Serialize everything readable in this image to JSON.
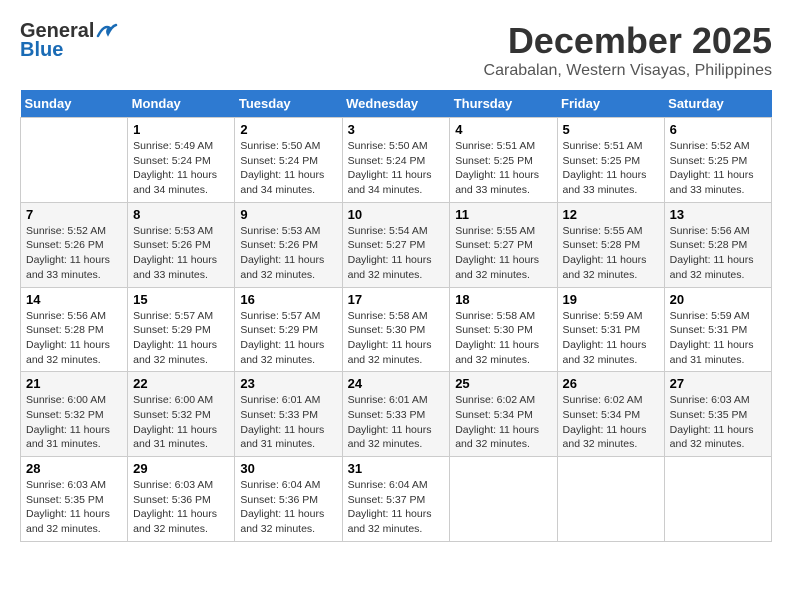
{
  "header": {
    "logo_general": "General",
    "logo_blue": "Blue",
    "month": "December 2025",
    "location": "Carabalan, Western Visayas, Philippines"
  },
  "weekdays": [
    "Sunday",
    "Monday",
    "Tuesday",
    "Wednesday",
    "Thursday",
    "Friday",
    "Saturday"
  ],
  "weeks": [
    [
      {
        "day": "",
        "info": ""
      },
      {
        "day": "1",
        "info": "Sunrise: 5:49 AM\nSunset: 5:24 PM\nDaylight: 11 hours and 34 minutes."
      },
      {
        "day": "2",
        "info": "Sunrise: 5:50 AM\nSunset: 5:24 PM\nDaylight: 11 hours and 34 minutes."
      },
      {
        "day": "3",
        "info": "Sunrise: 5:50 AM\nSunset: 5:24 PM\nDaylight: 11 hours and 34 minutes."
      },
      {
        "day": "4",
        "info": "Sunrise: 5:51 AM\nSunset: 5:25 PM\nDaylight: 11 hours and 33 minutes."
      },
      {
        "day": "5",
        "info": "Sunrise: 5:51 AM\nSunset: 5:25 PM\nDaylight: 11 hours and 33 minutes."
      },
      {
        "day": "6",
        "info": "Sunrise: 5:52 AM\nSunset: 5:25 PM\nDaylight: 11 hours and 33 minutes."
      }
    ],
    [
      {
        "day": "7",
        "info": "Sunrise: 5:52 AM\nSunset: 5:26 PM\nDaylight: 11 hours and 33 minutes."
      },
      {
        "day": "8",
        "info": "Sunrise: 5:53 AM\nSunset: 5:26 PM\nDaylight: 11 hours and 33 minutes."
      },
      {
        "day": "9",
        "info": "Sunrise: 5:53 AM\nSunset: 5:26 PM\nDaylight: 11 hours and 32 minutes."
      },
      {
        "day": "10",
        "info": "Sunrise: 5:54 AM\nSunset: 5:27 PM\nDaylight: 11 hours and 32 minutes."
      },
      {
        "day": "11",
        "info": "Sunrise: 5:55 AM\nSunset: 5:27 PM\nDaylight: 11 hours and 32 minutes."
      },
      {
        "day": "12",
        "info": "Sunrise: 5:55 AM\nSunset: 5:28 PM\nDaylight: 11 hours and 32 minutes."
      },
      {
        "day": "13",
        "info": "Sunrise: 5:56 AM\nSunset: 5:28 PM\nDaylight: 11 hours and 32 minutes."
      }
    ],
    [
      {
        "day": "14",
        "info": "Sunrise: 5:56 AM\nSunset: 5:28 PM\nDaylight: 11 hours and 32 minutes."
      },
      {
        "day": "15",
        "info": "Sunrise: 5:57 AM\nSunset: 5:29 PM\nDaylight: 11 hours and 32 minutes."
      },
      {
        "day": "16",
        "info": "Sunrise: 5:57 AM\nSunset: 5:29 PM\nDaylight: 11 hours and 32 minutes."
      },
      {
        "day": "17",
        "info": "Sunrise: 5:58 AM\nSunset: 5:30 PM\nDaylight: 11 hours and 32 minutes."
      },
      {
        "day": "18",
        "info": "Sunrise: 5:58 AM\nSunset: 5:30 PM\nDaylight: 11 hours and 32 minutes."
      },
      {
        "day": "19",
        "info": "Sunrise: 5:59 AM\nSunset: 5:31 PM\nDaylight: 11 hours and 32 minutes."
      },
      {
        "day": "20",
        "info": "Sunrise: 5:59 AM\nSunset: 5:31 PM\nDaylight: 11 hours and 31 minutes."
      }
    ],
    [
      {
        "day": "21",
        "info": "Sunrise: 6:00 AM\nSunset: 5:32 PM\nDaylight: 11 hours and 31 minutes."
      },
      {
        "day": "22",
        "info": "Sunrise: 6:00 AM\nSunset: 5:32 PM\nDaylight: 11 hours and 31 minutes."
      },
      {
        "day": "23",
        "info": "Sunrise: 6:01 AM\nSunset: 5:33 PM\nDaylight: 11 hours and 31 minutes."
      },
      {
        "day": "24",
        "info": "Sunrise: 6:01 AM\nSunset: 5:33 PM\nDaylight: 11 hours and 32 minutes."
      },
      {
        "day": "25",
        "info": "Sunrise: 6:02 AM\nSunset: 5:34 PM\nDaylight: 11 hours and 32 minutes."
      },
      {
        "day": "26",
        "info": "Sunrise: 6:02 AM\nSunset: 5:34 PM\nDaylight: 11 hours and 32 minutes."
      },
      {
        "day": "27",
        "info": "Sunrise: 6:03 AM\nSunset: 5:35 PM\nDaylight: 11 hours and 32 minutes."
      }
    ],
    [
      {
        "day": "28",
        "info": "Sunrise: 6:03 AM\nSunset: 5:35 PM\nDaylight: 11 hours and 32 minutes."
      },
      {
        "day": "29",
        "info": "Sunrise: 6:03 AM\nSunset: 5:36 PM\nDaylight: 11 hours and 32 minutes."
      },
      {
        "day": "30",
        "info": "Sunrise: 6:04 AM\nSunset: 5:36 PM\nDaylight: 11 hours and 32 minutes."
      },
      {
        "day": "31",
        "info": "Sunrise: 6:04 AM\nSunset: 5:37 PM\nDaylight: 11 hours and 32 minutes."
      },
      {
        "day": "",
        "info": ""
      },
      {
        "day": "",
        "info": ""
      },
      {
        "day": "",
        "info": ""
      }
    ]
  ]
}
